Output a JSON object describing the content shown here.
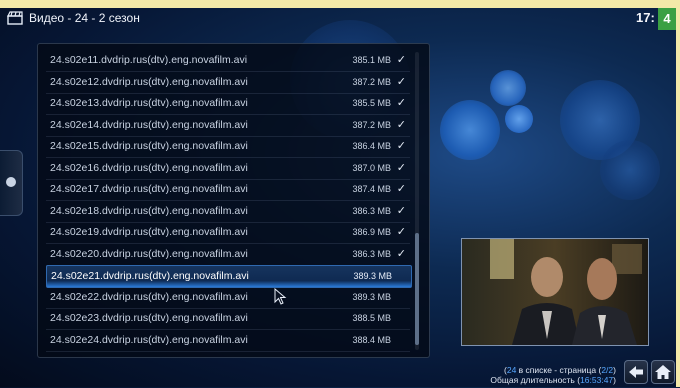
{
  "header": {
    "title": "Видео - 24 - 2 сезон",
    "clock": "17:",
    "badge": "4"
  },
  "list": {
    "items": [
      {
        "name": "24.s02e11.dvdrip.rus(dtv).eng.novafilm.avi",
        "size": "385.1 MB",
        "watched": "✓"
      },
      {
        "name": "24.s02e12.dvdrip.rus(dtv).eng.novafilm.avi",
        "size": "387.2 MB",
        "watched": "✓"
      },
      {
        "name": "24.s02e13.dvdrip.rus(dtv).eng.novafilm.avi",
        "size": "385.5 MB",
        "watched": "✓"
      },
      {
        "name": "24.s02e14.dvdrip.rus(dtv).eng.novafilm.avi",
        "size": "387.2 MB",
        "watched": "✓"
      },
      {
        "name": "24.s02e15.dvdrip.rus(dtv).eng.novafilm.avi",
        "size": "386.4 MB",
        "watched": "✓"
      },
      {
        "name": "24.s02e16.dvdrip.rus(dtv).eng.novafilm.avi",
        "size": "387.0 MB",
        "watched": "✓"
      },
      {
        "name": "24.s02e17.dvdrip.rus(dtv).eng.novafilm.avi",
        "size": "387.4 MB",
        "watched": "✓"
      },
      {
        "name": "24.s02e18.dvdrip.rus(dtv).eng.novafilm.avi",
        "size": "386.3 MB",
        "watched": "✓"
      },
      {
        "name": "24.s02e19.dvdrip.rus(dtv).eng.novafilm.avi",
        "size": "386.9 MB",
        "watched": "✓"
      },
      {
        "name": "24.s02e20.dvdrip.rus(dtv).eng.novafilm.avi",
        "size": "386.3 MB",
        "watched": "✓"
      },
      {
        "name": "24.s02e21.dvdrip.rus(dtv).eng.novafilm.avi",
        "size": "389.3 MB",
        "watched": ""
      },
      {
        "name": "24.s02e22.dvdrip.rus(dtv).eng.novafilm.avi",
        "size": "389.3 MB",
        "watched": ""
      },
      {
        "name": "24.s02e23.dvdrip.rus(dtv).eng.novafilm.avi",
        "size": "388.5 MB",
        "watched": ""
      },
      {
        "name": "24.s02e24.dvdrip.rus(dtv).eng.novafilm.avi",
        "size": "388.4 MB",
        "watched": ""
      }
    ],
    "selected_index": 10
  },
  "status": {
    "count": "24",
    "count_suffix": " в списке - страница (",
    "page": "2/2",
    "page_suffix": ")",
    "duration_prefix": "Общая длительность (",
    "duration": "16:53:47",
    "duration_suffix": ")"
  },
  "icons": {
    "video": "video-clapper-icon",
    "back": "back-arrow-icon",
    "home": "home-icon",
    "side": "side-menu-icon",
    "cursor": "mouse-pointer-icon"
  },
  "colors": {
    "accent": "#56a7ff",
    "badge": "#3aa043",
    "selection": "#2a7ad8"
  }
}
